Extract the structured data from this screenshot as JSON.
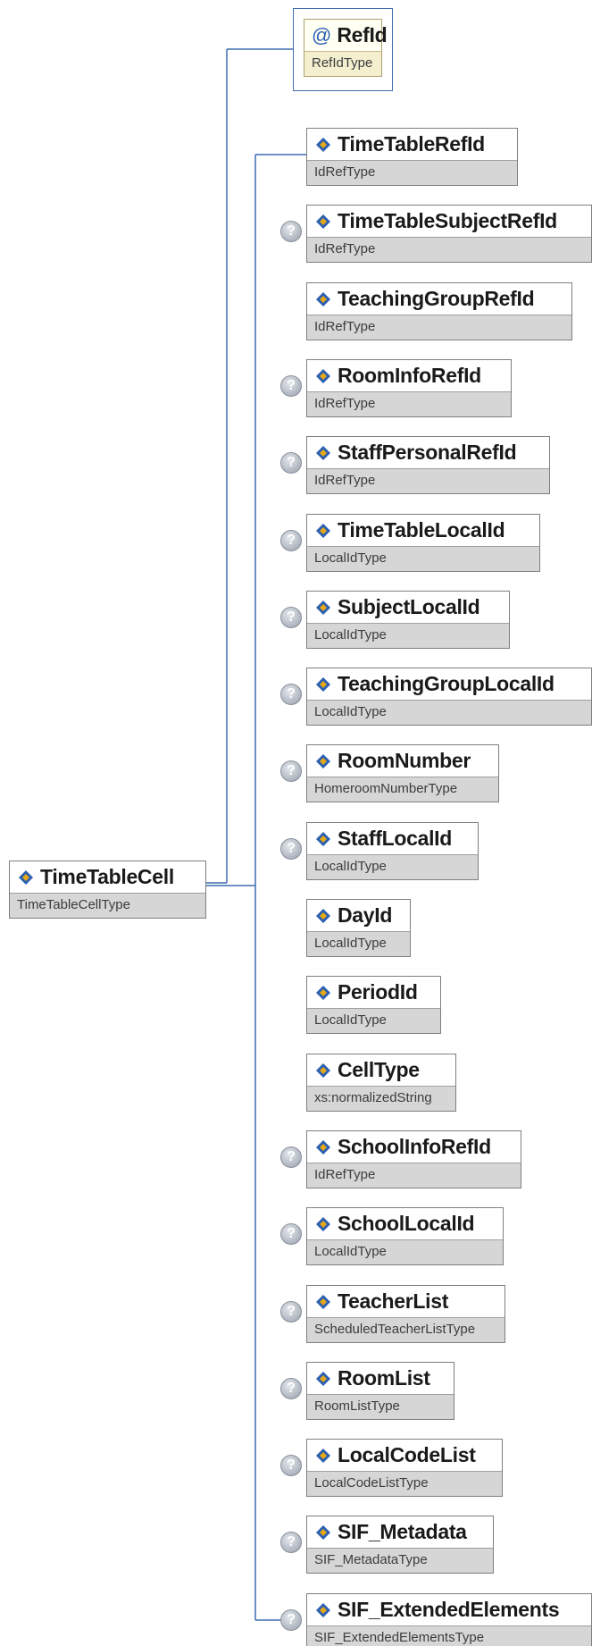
{
  "root": {
    "name": "TimeTableCell",
    "type": "TimeTableCellType"
  },
  "attribute": {
    "icon": "@",
    "name": "RefId",
    "type": "RefIdType"
  },
  "elements": [
    {
      "name": "TimeTableRefId",
      "type": "IdRefType",
      "optional": false
    },
    {
      "name": "TimeTableSubjectRefId",
      "type": "IdRefType",
      "optional": true
    },
    {
      "name": "TeachingGroupRefId",
      "type": "IdRefType",
      "optional": false
    },
    {
      "name": "RoomInfoRefId",
      "type": "IdRefType",
      "optional": true
    },
    {
      "name": "StaffPersonalRefId",
      "type": "IdRefType",
      "optional": true
    },
    {
      "name": "TimeTableLocalId",
      "type": "LocalIdType",
      "optional": true
    },
    {
      "name": "SubjectLocalId",
      "type": "LocalIdType",
      "optional": true
    },
    {
      "name": "TeachingGroupLocalId",
      "type": "LocalIdType",
      "optional": true
    },
    {
      "name": "RoomNumber",
      "type": "HomeroomNumberType",
      "optional": true
    },
    {
      "name": "StaffLocalId",
      "type": "LocalIdType",
      "optional": true
    },
    {
      "name": "DayId",
      "type": "LocalIdType",
      "optional": false
    },
    {
      "name": "PeriodId",
      "type": "LocalIdType",
      "optional": false
    },
    {
      "name": "CellType",
      "type": "xs:normalizedString",
      "optional": false
    },
    {
      "name": "SchoolInfoRefId",
      "type": "IdRefType",
      "optional": true
    },
    {
      "name": "SchoolLocalId",
      "type": "LocalIdType",
      "optional": true
    },
    {
      "name": "TeacherList",
      "type": "ScheduledTeacherListType",
      "optional": true
    },
    {
      "name": "RoomList",
      "type": "RoomListType",
      "optional": true
    },
    {
      "name": "LocalCodeList",
      "type": "LocalCodeListType",
      "optional": true
    },
    {
      "name": "SIF_Metadata",
      "type": "SIF_MetadataType",
      "optional": true
    },
    {
      "name": "SIF_ExtendedElements",
      "type": "SIF_ExtendedElementsType",
      "optional": true
    }
  ],
  "icons": {
    "element": "element-diamond-icon",
    "attribute": "at-sign-icon",
    "optional": "question-mark-icon"
  },
  "colors": {
    "connector": "#3d6db0",
    "icon_blue": "#2a5fb2",
    "icon_gold": "#e6a817",
    "type_band": "#d6d6d6"
  }
}
